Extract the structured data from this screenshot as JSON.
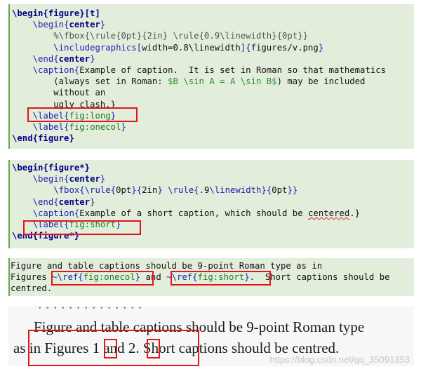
{
  "block1": {
    "l1": [
      "\\begin{",
      "figure",
      "}[t]"
    ],
    "l2": [
      "\\begin{",
      "center",
      "}"
    ],
    "l3": "%\\fbox{\\rule{0pt}{2in} \\rule{0.9\\linewidth}{0pt}}",
    "l4": [
      "\\includegraphics[",
      "width=0.8\\linewidth",
      "]{",
      "figures/v.png",
      "}"
    ],
    "l5": [
      "\\end{",
      "center",
      "}"
    ],
    "l6": [
      "\\caption{",
      "Example of caption.  It is set in Roman so that mathematics"
    ],
    "l7": [
      "(always set in Roman: ",
      "$B \\sin A = A \\sin B$",
      ") may be included"
    ],
    "l8": "without an",
    "l9": "ugly clash.}",
    "l10": [
      "\\label{",
      "fig:long",
      "}"
    ],
    "l11": [
      "\\label{",
      "fig:onecol",
      "}"
    ],
    "l12": [
      "\\end{",
      "figure",
      "}"
    ]
  },
  "block2": {
    "l1": [
      "\\begin{",
      "figure*",
      "}"
    ],
    "l2": [
      "\\begin{",
      "center",
      "}"
    ],
    "l3": [
      "\\fbox{",
      "\\rule{",
      "0pt",
      "}{",
      "2in",
      "} ",
      "\\rule{",
      ".9",
      "\\linewidth",
      "}{",
      "0pt",
      "}}"
    ],
    "l4": [
      "\\end{",
      "center",
      "}"
    ],
    "l5": [
      "\\caption{",
      "Example of a short caption, which should be ",
      "centered",
      ".}"
    ],
    "l6": [
      "\\label{",
      "fig:short",
      "}"
    ],
    "l7": [
      "\\end{",
      "figure*",
      "}"
    ]
  },
  "block3": {
    "l1": "Figure and table captions should be 9-point Roman type as in",
    "l2": [
      "Figures ",
      "~\\ref{",
      "fig:onecol",
      "}",
      " and ",
      "~\\ref{",
      "fig:short",
      "}",
      ".  Short captions should be"
    ],
    "l3": "centred."
  },
  "rendered": {
    "top_fragment": "partial line",
    "line1": "Figure and table captions should be 9-point Roman type",
    "line2_prefix": "as in Figures ",
    "ref1": "1",
    "line2_mid": " and ",
    "ref2": "2",
    "line2_suffix": ". Short captions should be centred.",
    "bottom_fragment": "partial line",
    "watermark": "https://blog.csdn.net/qq_35091353"
  },
  "colors": {
    "block_bg": "#e2eedb",
    "block_border": "#6aa84f",
    "highlight": "#e0161b"
  }
}
